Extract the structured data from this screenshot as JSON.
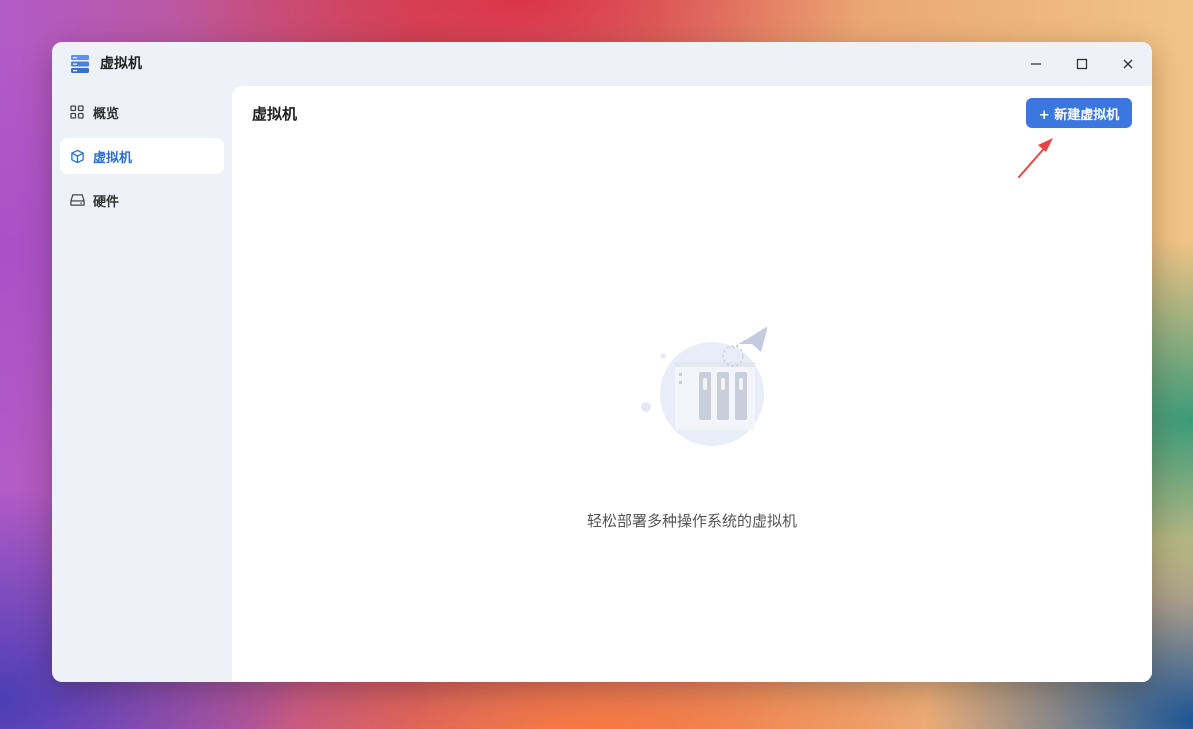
{
  "window": {
    "title": "虚拟机",
    "app_icon": "server-stack-icon",
    "controls": {
      "minimize": "minimize-icon",
      "maximize": "maximize-icon",
      "close": "close-icon"
    }
  },
  "sidebar": {
    "items": [
      {
        "label": "概览",
        "icon": "grid-icon",
        "active": false
      },
      {
        "label": "虚拟机",
        "icon": "cube-icon",
        "active": true
      },
      {
        "label": "硬件",
        "icon": "drive-icon",
        "active": false
      }
    ]
  },
  "main": {
    "title": "虚拟机",
    "new_button_label": "+ 新建虚拟机",
    "empty_state_text": "轻松部署多种操作系统的虚拟机"
  },
  "colors": {
    "accent": "#3a78e0",
    "active_nav_text": "#2b6fd6",
    "annotation_arrow": "#e84343"
  }
}
